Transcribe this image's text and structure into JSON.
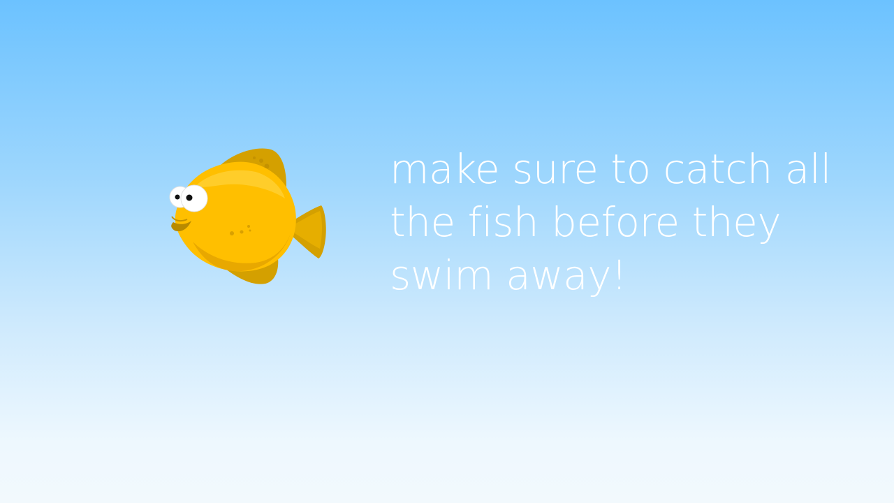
{
  "scene": {
    "background_top": "#6cc2ff",
    "background_bottom": "#f2f9fd"
  },
  "fish": {
    "icon": "yellow-fish-icon",
    "body_color": "#ffbf00",
    "fin_color": "#d4a000",
    "eye_color": "#ffffff"
  },
  "message": {
    "text": "make sure to catch all the fish before they swim away!",
    "color": "#ffffff"
  }
}
